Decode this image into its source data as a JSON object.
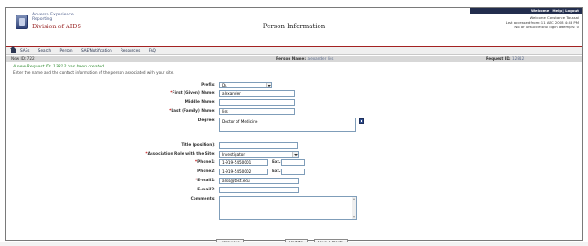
{
  "header": {
    "logo_line1": "Adverse Experience",
    "logo_line2": "Reporting",
    "logo_line3": "Division of AIDS",
    "title": "Person Information",
    "user_strip": "Welcome | Help | Logout",
    "welcome_line1": "Welcome Constance Toussai",
    "welcome_line2": "Last accessed from: 11 ABC 2008 4:48 PM",
    "welcome_line3": "No. of unsuccessful login attempts: 0"
  },
  "nav": {
    "items": [
      "SAEs",
      "Search",
      "Person",
      "SAE/Notification",
      "Resources",
      "FAQ"
    ]
  },
  "infobar": {
    "revision": "New ID: 722",
    "person_label": "Person Name:",
    "person_value": "alexander liss",
    "request_label": "Request ID:",
    "request_value": "12812"
  },
  "messages": {
    "success": "A new Request ID: 12812 has been created.",
    "instructions": "Enter the name and the contact information of the person associated with your site."
  },
  "form": {
    "prefix": {
      "label": "Prefix:",
      "value": "Dr."
    },
    "first_name": {
      "label": "First (Given) Name:",
      "value": "alexander"
    },
    "middle_name": {
      "label": "Middle Name:",
      "value": ""
    },
    "last_name": {
      "label": "Last (Family) Name:",
      "value": "liss"
    },
    "degree": {
      "label": "Degree:",
      "value": "Doctor of Medicine"
    },
    "title": {
      "label": "Title (position):",
      "value": ""
    },
    "association_role": {
      "label": "Association Role with the Site:",
      "value": "Investigator"
    },
    "phone1": {
      "label": "Phone1:",
      "value": "1-919-5450001",
      "ext_label": "Ext.:",
      "ext_value": ""
    },
    "phone2": {
      "label": "Phone2:",
      "value": "1-919-5450002",
      "ext_label": "Ext.:",
      "ext_value": ""
    },
    "email1": {
      "label": "E-mail1:",
      "value": "aliss@test.edu"
    },
    "email2": {
      "label": "E-mail2:",
      "value": ""
    },
    "comments": {
      "label": "Comments:",
      "value": ""
    }
  },
  "buttons": {
    "previous": "<Previous",
    "update": "Update",
    "save_next": "Save & Next>"
  },
  "colors": {
    "header_strip": "#222d4d",
    "accent_red": "#a32222",
    "success_green": "#2c8a2c",
    "required_red": "#c41e1e"
  }
}
